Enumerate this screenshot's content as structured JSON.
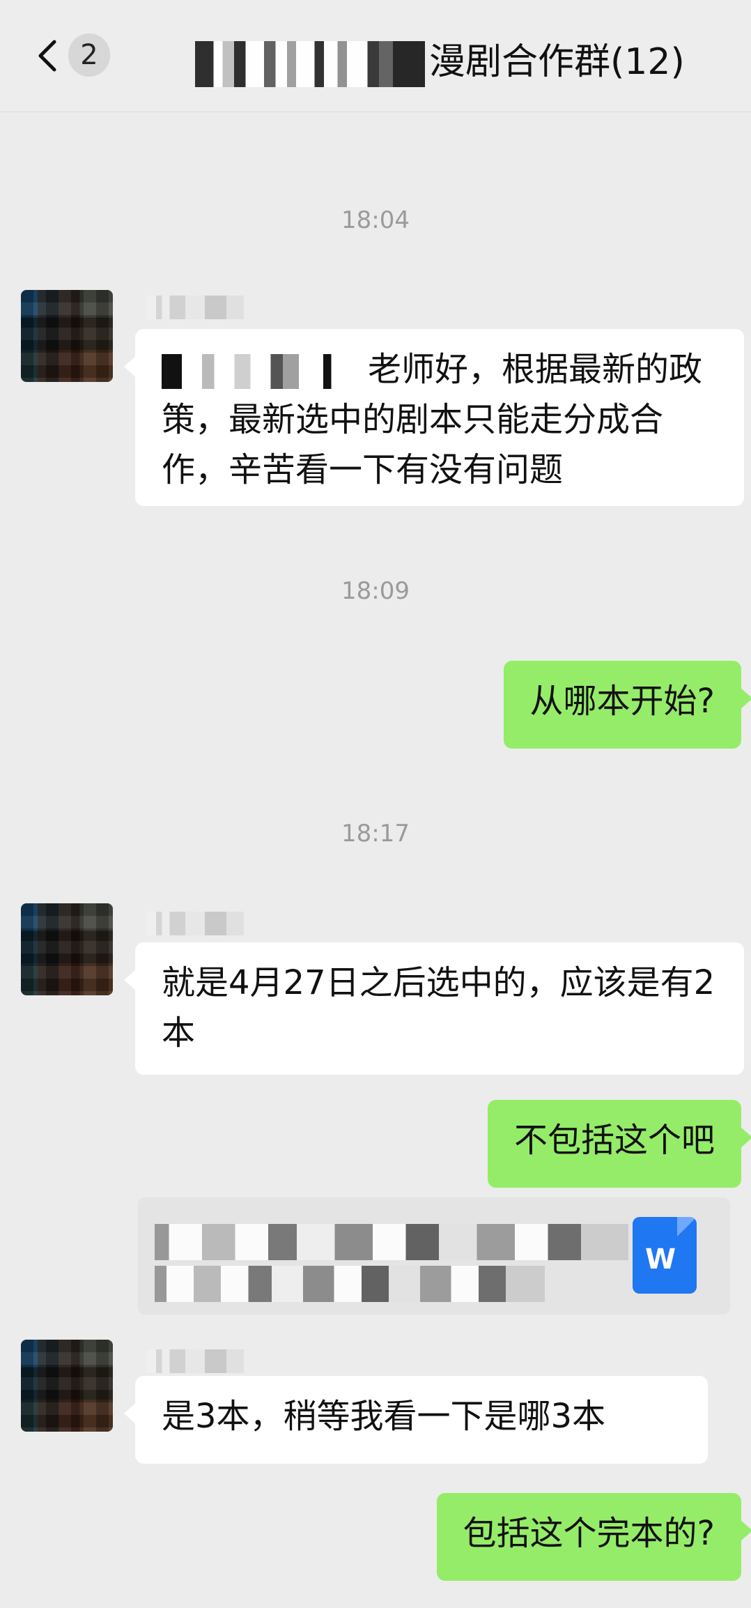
{
  "header": {
    "back_badge": "2",
    "title_suffix": "漫剧合作群(12)"
  },
  "times": [
    "18:04",
    "18:09",
    "18:17"
  ],
  "messages": {
    "in_1": "老师好，根据最新的政策，最新选中的剧本只能走分成合作，辛苦看一下有没有问题",
    "out_1": "从哪本开始?",
    "in_2": "就是4月27日之后选中的，应该是有2本",
    "out_2": "不包括这个吧",
    "in_3": "是3本，稍等我看一下是哪3本",
    "out_3": "包括这个完本的?"
  },
  "icons": {
    "back": "chevron-left-icon",
    "document": "word-document-icon"
  },
  "colors": {
    "incoming_bubble": "#ffffff",
    "outgoing_bubble": "#95ec69",
    "background": "#ececec"
  }
}
